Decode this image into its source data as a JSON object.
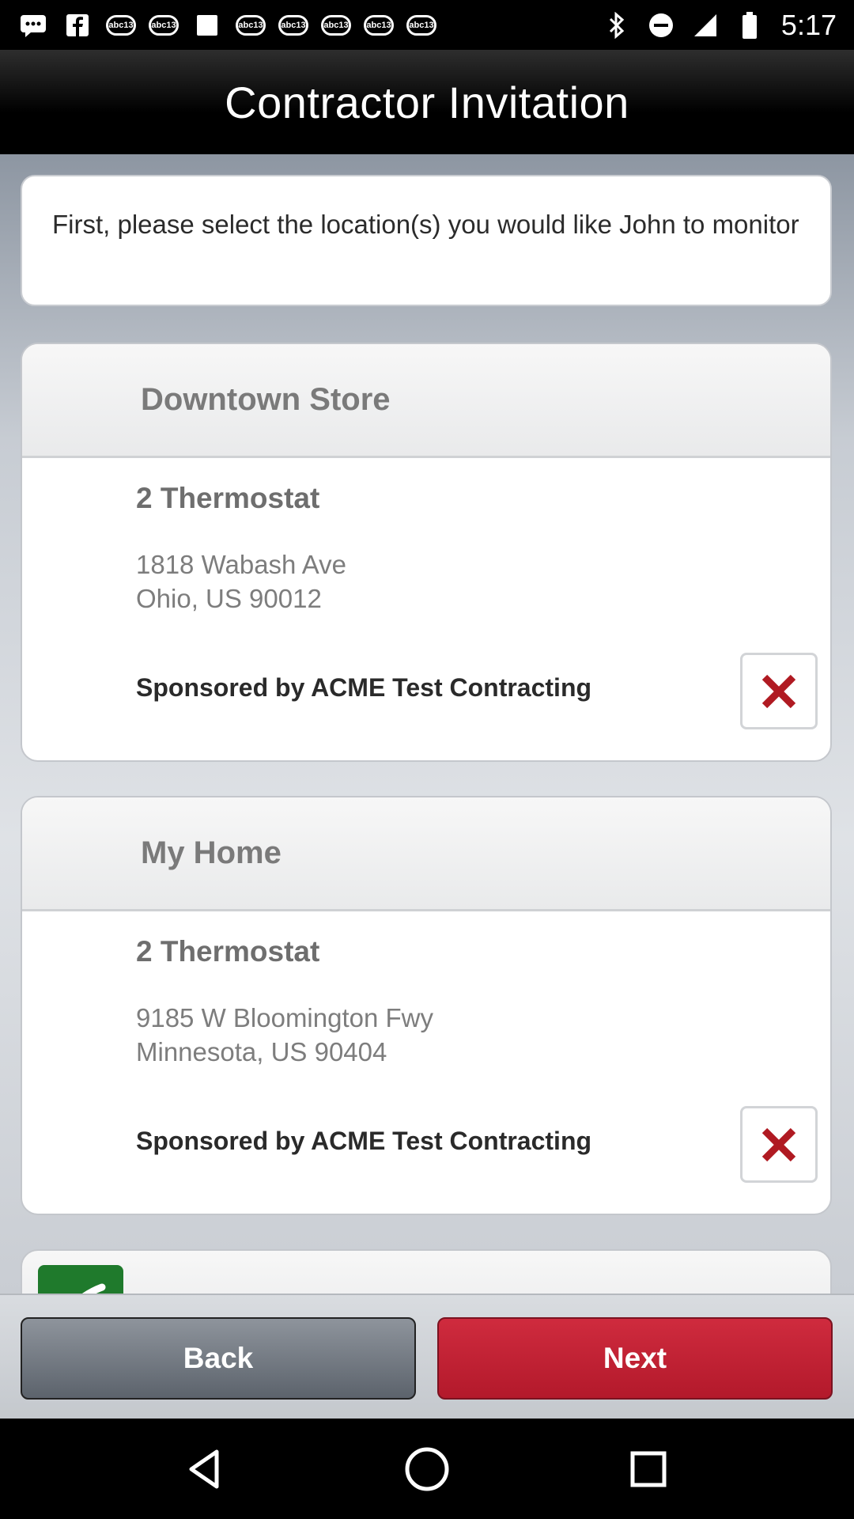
{
  "status_bar": {
    "time": "5:17",
    "badges": [
      "abc13",
      "abc13",
      "abc13",
      "abc13",
      "abc13",
      "abc13",
      "abc13"
    ],
    "icons": [
      "message-icon",
      "facebook-icon",
      "image-icon",
      "bluetooth-icon",
      "do-not-disturb-icon",
      "signal-icon",
      "battery-icon"
    ]
  },
  "header": {
    "title": "Contractor Invitation"
  },
  "intro": {
    "text": "First, please select the location(s) you would like John to monitor"
  },
  "locations": [
    {
      "name": "Downtown Store",
      "devices": "2 Thermostat",
      "address_line1": "1818 Wabash Ave",
      "address_line2": "Ohio, US 90012",
      "sponsor": "Sponsored by ACME Test Contracting"
    },
    {
      "name": "My Home",
      "devices": "2 Thermostat",
      "address_line1": "9185 W Bloomington Fwy",
      "address_line2": "Minnesota, US 90404",
      "sponsor": "Sponsored by ACME Test Contracting"
    }
  ],
  "actions": {
    "back_label": "Back",
    "next_label": "Next"
  },
  "colors": {
    "next": "#c0202f",
    "back": "#6b727b",
    "remove": "#b01a22",
    "check": "#1f7a2c"
  }
}
